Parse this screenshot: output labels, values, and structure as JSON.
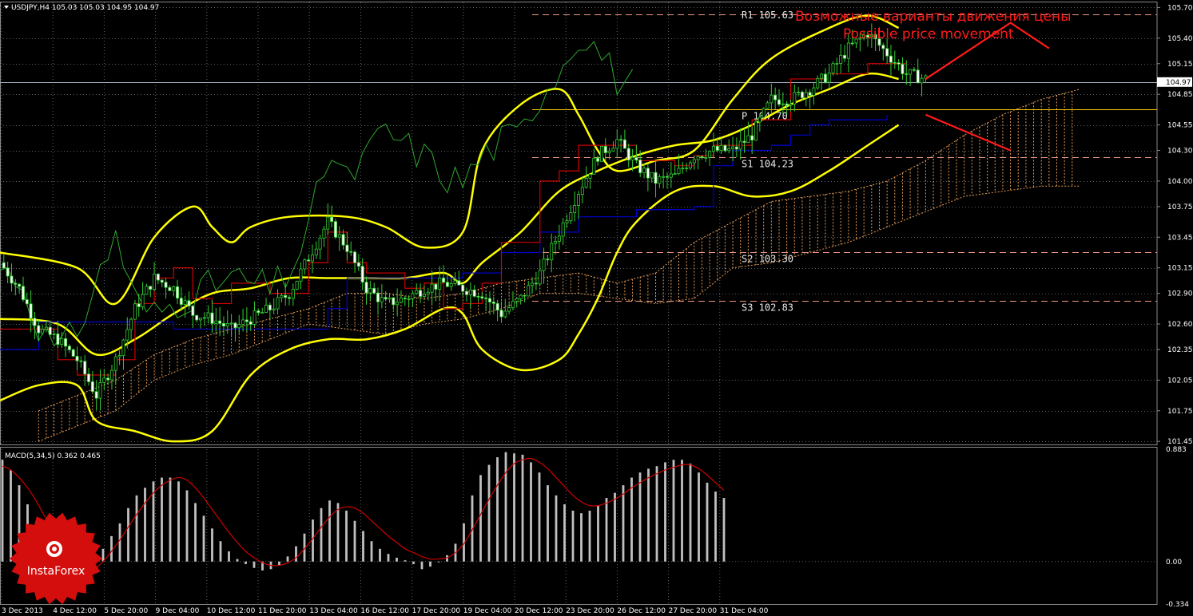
{
  "chart_data": [
    {
      "type": "candlestick",
      "panel": "main",
      "header": "USDJPY,H4  105.03 105.03 104.95 104.97",
      "current_price_label": "104.97",
      "ylim": [
        101.42,
        105.75
      ],
      "y_ticks": [
        "105.70",
        "105.40",
        "105.15",
        "104.85",
        "104.55",
        "104.30",
        "104.00",
        "103.75",
        "103.45",
        "103.15",
        "102.90",
        "102.60",
        "102.35",
        "102.05",
        "101.75",
        "101.45"
      ],
      "x_ticks": [
        "3 Dec 2013",
        "4 Dec 12:00",
        "5 Dec 20:00",
        "9 Dec 04:00",
        "10 Dec 12:00",
        "11 Dec 20:00",
        "13 Dec 04:00",
        "16 Dec 12:00",
        "17 Dec 20:00",
        "19 Dec 04:00",
        "20 Dec 12:00",
        "23 Dec 20:00",
        "26 Dec 12:00",
        "27 Dec 20:00",
        "31 Dec 04:00"
      ],
      "pivot_levels": [
        {
          "label": "R1 105.63",
          "value": 105.63,
          "style": "dashed"
        },
        {
          "label": "P 104.70",
          "value": 104.7,
          "style": "solid"
        },
        {
          "label": "S1 104.23",
          "value": 104.23,
          "style": "dashed"
        },
        {
          "label": "S2 103.30",
          "value": 103.3,
          "style": "dashed"
        },
        {
          "label": "S3 102.83",
          "value": 102.83,
          "style": "dashed"
        }
      ],
      "current_price": 104.97,
      "annotation": {
        "line1": "Возможные варианты движения цены",
        "line2": "Possible price movement"
      },
      "price_path": [
        [
          0,
          103.2
        ],
        [
          5,
          102.95
        ],
        [
          10,
          102.55
        ],
        [
          15,
          102.45
        ],
        [
          20,
          102.25
        ],
        [
          25,
          101.9
        ],
        [
          30,
          102.25
        ],
        [
          35,
          102.75
        ],
        [
          40,
          103.05
        ],
        [
          45,
          102.95
        ],
        [
          50,
          102.7
        ],
        [
          55,
          102.65
        ],
        [
          60,
          102.55
        ],
        [
          65,
          102.65
        ],
        [
          70,
          102.75
        ],
        [
          75,
          102.9
        ],
        [
          80,
          103.25
        ],
        [
          85,
          103.6
        ],
        [
          90,
          103.35
        ],
        [
          95,
          102.95
        ],
        [
          100,
          102.8
        ],
        [
          105,
          102.85
        ],
        [
          110,
          102.95
        ],
        [
          115,
          103.0
        ],
        [
          120,
          102.95
        ],
        [
          125,
          102.9
        ],
        [
          130,
          102.7
        ],
        [
          135,
          102.85
        ],
        [
          140,
          103.1
        ],
        [
          145,
          103.5
        ],
        [
          150,
          103.9
        ],
        [
          155,
          104.25
        ],
        [
          160,
          104.4
        ],
        [
          165,
          104.15
        ],
        [
          170,
          104.0
        ],
        [
          175,
          104.05
        ],
        [
          180,
          104.25
        ],
        [
          185,
          104.3
        ],
        [
          190,
          104.3
        ],
        [
          195,
          104.45
        ],
        [
          200,
          104.8
        ],
        [
          205,
          104.8
        ],
        [
          210,
          104.9
        ],
        [
          215,
          105.05
        ],
        [
          220,
          105.3
        ],
        [
          225,
          105.45
        ],
        [
          230,
          105.25
        ],
        [
          235,
          105.05
        ],
        [
          240,
          105.0
        ]
      ],
      "bollinger_upper": [
        [
          0,
          103.3
        ],
        [
          20,
          103.15
        ],
        [
          30,
          102.8
        ],
        [
          40,
          103.45
        ],
        [
          50,
          103.75
        ],
        [
          55,
          103.55
        ],
        [
          60,
          103.4
        ],
        [
          65,
          103.55
        ],
        [
          75,
          103.65
        ],
        [
          90,
          103.65
        ],
        [
          100,
          103.55
        ],
        [
          110,
          103.35
        ],
        [
          120,
          103.5
        ],
        [
          125,
          104.3
        ],
        [
          135,
          104.75
        ],
        [
          145,
          104.9
        ],
        [
          150,
          104.65
        ],
        [
          155,
          104.3
        ],
        [
          160,
          104.1
        ],
        [
          170,
          104.2
        ],
        [
          180,
          104.3
        ],
        [
          190,
          104.8
        ],
        [
          200,
          105.2
        ],
        [
          215,
          105.5
        ],
        [
          225,
          105.62
        ],
        [
          233,
          105.5
        ]
      ],
      "bollinger_middle": [
        [
          0,
          102.65
        ],
        [
          15,
          102.6
        ],
        [
          25,
          102.3
        ],
        [
          35,
          102.45
        ],
        [
          45,
          102.7
        ],
        [
          55,
          102.9
        ],
        [
          65,
          102.95
        ],
        [
          75,
          103.05
        ],
        [
          85,
          103.05
        ],
        [
          95,
          103.05
        ],
        [
          105,
          103.05
        ],
        [
          115,
          103.1
        ],
        [
          120,
          103.0
        ],
        [
          125,
          103.2
        ],
        [
          135,
          103.5
        ],
        [
          145,
          103.9
        ],
        [
          155,
          104.1
        ],
        [
          165,
          104.25
        ],
        [
          175,
          104.35
        ],
        [
          185,
          104.4
        ],
        [
          195,
          104.55
        ],
        [
          205,
          104.75
        ],
        [
          215,
          104.9
        ],
        [
          225,
          105.05
        ],
        [
          233,
          105.0
        ]
      ],
      "bollinger_lower": [
        [
          0,
          101.85
        ],
        [
          10,
          102.0
        ],
        [
          20,
          102.0
        ],
        [
          25,
          101.65
        ],
        [
          35,
          101.55
        ],
        [
          45,
          101.45
        ],
        [
          55,
          101.55
        ],
        [
          65,
          102.1
        ],
        [
          75,
          102.35
        ],
        [
          85,
          102.45
        ],
        [
          95,
          102.45
        ],
        [
          105,
          102.55
        ],
        [
          115,
          102.75
        ],
        [
          120,
          102.7
        ],
        [
          125,
          102.35
        ],
        [
          135,
          102.15
        ],
        [
          145,
          102.25
        ],
        [
          150,
          102.5
        ],
        [
          155,
          102.85
        ],
        [
          160,
          103.3
        ],
        [
          165,
          103.6
        ],
        [
          175,
          103.9
        ],
        [
          185,
          103.95
        ],
        [
          195,
          103.85
        ],
        [
          205,
          103.9
        ],
        [
          215,
          104.1
        ],
        [
          225,
          104.35
        ],
        [
          233,
          104.55
        ]
      ],
      "tenkan": [
        [
          0,
          102.55
        ],
        [
          10,
          102.55
        ],
        [
          15,
          102.25
        ],
        [
          20,
          102.1
        ],
        [
          30,
          102.25
        ],
        [
          35,
          102.8
        ],
        [
          40,
          103.05
        ],
        [
          45,
          103.15
        ],
        [
          50,
          102.85
        ],
        [
          55,
          102.8
        ],
        [
          60,
          103.0
        ],
        [
          70,
          102.9
        ],
        [
          80,
          103.2
        ],
        [
          85,
          103.5
        ],
        [
          90,
          103.2
        ],
        [
          95,
          103.1
        ],
        [
          105,
          102.95
        ],
        [
          110,
          103.0
        ],
        [
          115,
          102.75
        ],
        [
          120,
          102.8
        ],
        [
          125,
          103.0
        ],
        [
          130,
          103.4
        ],
        [
          140,
          104.0
        ],
        [
          145,
          104.1
        ],
        [
          150,
          104.35
        ],
        [
          160,
          104.35
        ],
        [
          165,
          104.2
        ],
        [
          175,
          104.15
        ],
        [
          180,
          104.25
        ],
        [
          185,
          104.35
        ],
        [
          190,
          104.35
        ],
        [
          195,
          104.6
        ],
        [
          205,
          105.0
        ],
        [
          210,
          105.0
        ],
        [
          215,
          105.05
        ],
        [
          225,
          105.15
        ],
        [
          235,
          105.15
        ]
      ],
      "kijun": [
        [
          0,
          102.35
        ],
        [
          10,
          102.62
        ],
        [
          20,
          102.62
        ],
        [
          40,
          102.62
        ],
        [
          45,
          102.55
        ],
        [
          55,
          102.55
        ],
        [
          60,
          102.55
        ],
        [
          75,
          102.55
        ],
        [
          85,
          102.75
        ],
        [
          90,
          103.05
        ],
        [
          100,
          103.05
        ],
        [
          110,
          103.05
        ],
        [
          120,
          103.1
        ],
        [
          130,
          103.3
        ],
        [
          140,
          103.5
        ],
        [
          150,
          103.65
        ],
        [
          160,
          103.65
        ],
        [
          165,
          103.72
        ],
        [
          175,
          103.72
        ],
        [
          180,
          103.75
        ],
        [
          185,
          104.15
        ],
        [
          190,
          104.3
        ],
        [
          200,
          104.35
        ],
        [
          205,
          104.45
        ],
        [
          210,
          104.55
        ],
        [
          215,
          104.6
        ],
        [
          225,
          104.6
        ],
        [
          230,
          104.65
        ]
      ],
      "chikou": [
        [
          0,
          103.15
        ],
        [
          5,
          103.05
        ],
        [
          10,
          102.6
        ],
        [
          15,
          102.3
        ],
        [
          20,
          102.55
        ],
        [
          25,
          103.0
        ],
        [
          30,
          103.5
        ],
        [
          35,
          102.8
        ],
        [
          40,
          102.7
        ],
        [
          50,
          102.9
        ],
        [
          60,
          103.05
        ],
        [
          70,
          102.95
        ],
        [
          75,
          103.1
        ],
        [
          80,
          103.5
        ],
        [
          85,
          104.3
        ],
        [
          90,
          104.0
        ],
        [
          95,
          104.25
        ],
        [
          100,
          104.5
        ],
        [
          105,
          104.35
        ],
        [
          110,
          104.25
        ],
        [
          115,
          104.05
        ],
        [
          120,
          104.0
        ],
        [
          125,
          104.25
        ],
        [
          130,
          104.4
        ],
        [
          135,
          104.45
        ],
        [
          140,
          104.85
        ],
        [
          145,
          105.1
        ],
        [
          150,
          105.45
        ],
        [
          155,
          105.3
        ],
        [
          160,
          105.0
        ],
        [
          165,
          104.95
        ]
      ],
      "cloud": [
        [
          10,
          101.75,
          101.45
        ],
        [
          20,
          101.9,
          101.6
        ],
        [
          30,
          102.05,
          101.75
        ],
        [
          40,
          102.3,
          102.05
        ],
        [
          50,
          102.45,
          102.2
        ],
        [
          60,
          102.55,
          102.3
        ],
        [
          70,
          102.65,
          102.45
        ],
        [
          80,
          102.75,
          102.6
        ],
        [
          90,
          102.9,
          102.55
        ],
        [
          100,
          102.9,
          102.5
        ],
        [
          110,
          102.85,
          102.6
        ],
        [
          120,
          102.9,
          102.65
        ],
        [
          130,
          103.0,
          102.75
        ],
        [
          140,
          103.05,
          102.9
        ],
        [
          150,
          103.1,
          102.9
        ],
        [
          160,
          103.0,
          102.85
        ],
        [
          170,
          103.1,
          102.8
        ],
        [
          180,
          103.4,
          102.85
        ],
        [
          190,
          103.6,
          103.15
        ],
        [
          200,
          103.8,
          103.2
        ],
        [
          210,
          103.85,
          103.3
        ],
        [
          220,
          103.9,
          103.4
        ],
        [
          230,
          104.0,
          103.55
        ],
        [
          240,
          104.2,
          103.7
        ],
        [
          250,
          104.45,
          103.85
        ],
        [
          260,
          104.65,
          103.9
        ],
        [
          270,
          104.8,
          103.95
        ],
        [
          280,
          104.9,
          103.95
        ]
      ],
      "forecast_up": [
        [
          240,
          105.0
        ],
        [
          262,
          105.55
        ],
        [
          272,
          105.3
        ]
      ],
      "forecast_down": [
        [
          240,
          104.65
        ],
        [
          262,
          104.3
        ]
      ]
    },
    {
      "type": "bar",
      "panel": "MACD",
      "label": "MACD(5,34,5) 0.362 0.465",
      "ylim": [
        -0.334,
        0.883
      ],
      "y_ticks": [
        "0.883",
        "0.00",
        "-0.334"
      ],
      "values": [
        0.8,
        0.72,
        0.6,
        0.45,
        0.3,
        0.15,
        0.02,
        -0.05,
        -0.12,
        -0.1,
        -0.04,
        0.03,
        0.1,
        0.2,
        0.3,
        0.42,
        0.52,
        0.58,
        0.63,
        0.66,
        0.66,
        0.63,
        0.56,
        0.46,
        0.36,
        0.26,
        0.16,
        0.08,
        0.02,
        -0.02,
        -0.05,
        -0.07,
        -0.06,
        -0.03,
        0.04,
        0.12,
        0.22,
        0.33,
        0.42,
        0.48,
        0.46,
        0.4,
        0.32,
        0.24,
        0.16,
        0.1,
        0.06,
        0.03,
        0.01,
        -0.02,
        -0.06,
        -0.04,
        0.0,
        0.05,
        0.14,
        0.3,
        0.52,
        0.68,
        0.76,
        0.82,
        0.86,
        0.85,
        0.84,
        0.78,
        0.7,
        0.6,
        0.52,
        0.45,
        0.4,
        0.38,
        0.4,
        0.44,
        0.5,
        0.54,
        0.6,
        0.66,
        0.7,
        0.73,
        0.75,
        0.78,
        0.8,
        0.8,
        0.77,
        0.7,
        0.62,
        0.55,
        0.5
      ],
      "signal": [
        0.75,
        0.72,
        0.66,
        0.58,
        0.48,
        0.36,
        0.24,
        0.12,
        0.02,
        -0.05,
        -0.08,
        -0.06,
        0.0,
        0.08,
        0.17,
        0.27,
        0.37,
        0.46,
        0.54,
        0.6,
        0.64,
        0.66,
        0.64,
        0.58,
        0.5,
        0.41,
        0.32,
        0.23,
        0.15,
        0.08,
        0.03,
        -0.01,
        -0.03,
        -0.03,
        -0.01,
        0.03,
        0.1,
        0.18,
        0.27,
        0.35,
        0.41,
        0.43,
        0.42,
        0.38,
        0.32,
        0.26,
        0.2,
        0.15,
        0.1,
        0.07,
        0.04,
        0.02,
        0.02,
        0.03,
        0.07,
        0.14,
        0.25,
        0.37,
        0.49,
        0.6,
        0.7,
        0.77,
        0.8,
        0.81,
        0.78,
        0.73,
        0.66,
        0.59,
        0.52,
        0.47,
        0.44,
        0.44,
        0.46,
        0.49,
        0.53,
        0.58,
        0.62,
        0.66,
        0.69,
        0.72,
        0.74,
        0.76,
        0.76,
        0.73,
        0.68,
        0.62,
        0.56
      ]
    }
  ],
  "watermark": {
    "brand": "InstaForex",
    "color": "#d40d0d"
  },
  "colors": {
    "background": "#000000",
    "grid": "#5a6470",
    "candle": "#32cd32",
    "bollinger": "#ffff00",
    "tenkan": "#d00000",
    "kijun": "#0000d0",
    "chikou": "#2ea82e",
    "cloud": "#e49a56",
    "pivot": "#f09a86",
    "pivot_p": "#ffd000",
    "current": "#a8b4c4",
    "forecast": "#ff1a1a",
    "macd_bar": "#c0c0c0",
    "macd_signal": "#d00000"
  }
}
